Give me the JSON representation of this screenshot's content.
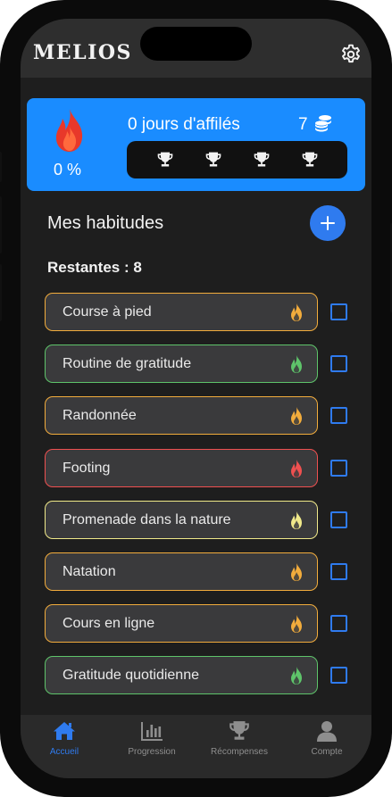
{
  "app": {
    "title": "MELIOS"
  },
  "streak": {
    "percent": "0 %",
    "days_text": "0 jours d'affilés",
    "coins": "7",
    "trophies": 4
  },
  "habits_section": {
    "title": "Mes habitudes",
    "remaining_label": "Restantes : 8"
  },
  "habits": [
    {
      "name": "Course à pied",
      "color": "#f2ac3c",
      "checked": false
    },
    {
      "name": "Routine de gratitude",
      "color": "#5ec46a",
      "checked": false
    },
    {
      "name": "Randonnée",
      "color": "#f2ac3c",
      "checked": false
    },
    {
      "name": "Footing",
      "color": "#ef5050",
      "checked": false
    },
    {
      "name": "Promenade dans la nature",
      "color": "#f0e98a",
      "checked": false
    },
    {
      "name": "Natation",
      "color": "#f2ac3c",
      "checked": false
    },
    {
      "name": "Cours en ligne",
      "color": "#f2ac3c",
      "checked": false
    },
    {
      "name": "Gratitude quotidienne",
      "color": "#5ec46a",
      "checked": false
    }
  ],
  "tabs": [
    {
      "label": "Accueil",
      "icon": "home-icon",
      "active": true
    },
    {
      "label": "Progression",
      "icon": "bar-chart-icon",
      "active": false
    },
    {
      "label": "Récompenses",
      "icon": "trophy-icon",
      "active": false
    },
    {
      "label": "Compte",
      "icon": "user-icon",
      "active": false
    }
  ],
  "colors": {
    "accent": "#2f7bef",
    "card": "#1a8cff",
    "background": "#1e1e1e",
    "flame_red": "#ef4a3a"
  }
}
